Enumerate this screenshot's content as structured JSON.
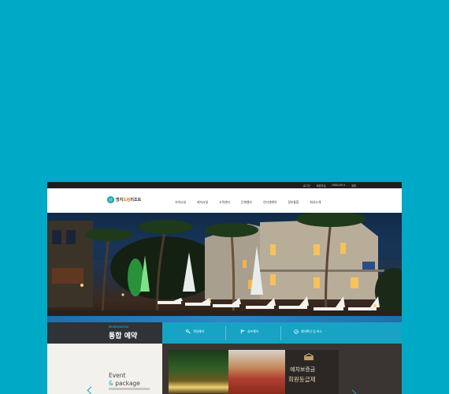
{
  "util_links": [
    "로그인",
    "회원가입",
    "ENGLISH ▾",
    "위원"
  ],
  "logo": {
    "prefix": "명지",
    "accent": "도림",
    "suffix": "리조트"
  },
  "nav": [
    "숙박시설",
    "레저시설",
    "고객센터",
    "단체행사",
    "인터넷예약",
    "정보통합",
    "회사소개"
  ],
  "reservation": {
    "sub": "RESERVATION",
    "title": "통합 예약",
    "items": [
      {
        "label": "객실예약",
        "icon": "key-icon"
      },
      {
        "label": "골프예약",
        "icon": "golf-flag-icon"
      },
      {
        "label": "예약확인 및 취소",
        "icon": "check-circle-icon"
      }
    ]
  },
  "event": {
    "line1": "Event",
    "amp": "&",
    "line2": "package"
  },
  "promo": {
    "line1": "예치보증금",
    "line2": "회원등급제"
  },
  "colors": {
    "background": "#00a9c6",
    "accent": "#16a3c4",
    "dark": "#2f3338"
  }
}
